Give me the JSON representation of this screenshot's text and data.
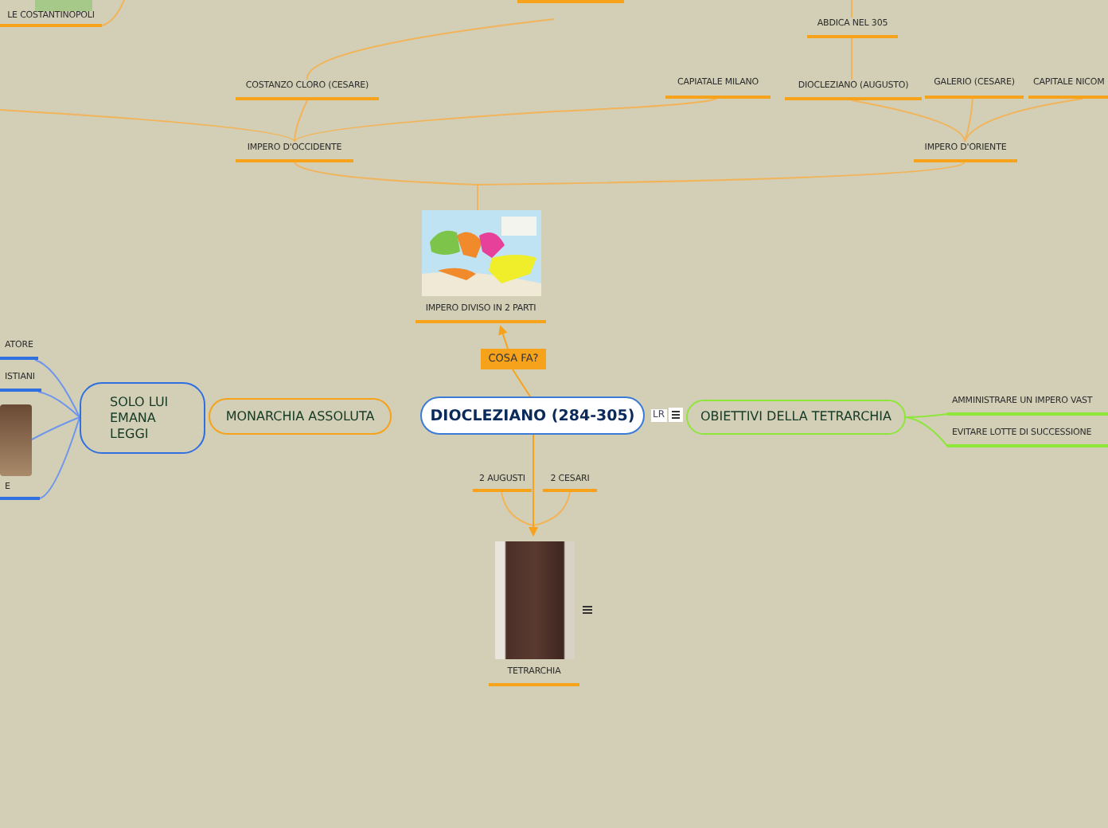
{
  "central": {
    "title": "DIOCLEZIANO (284-305)",
    "layout_badge": "LR",
    "notes": true
  },
  "nodes": [
    {
      "kind": "topic",
      "text": "LE COSTANTINOPOLI",
      "color": "#f7a21b"
    },
    {
      "kind": "topic",
      "text": "COSTANZO CLORO (CESARE)",
      "color": "#f7a21b"
    },
    {
      "kind": "topic",
      "text": "IMPERO D'OCCIDENTE",
      "color": "#f7a21b"
    },
    {
      "kind": "topic",
      "text": "ABDICA NEL 305",
      "color": "#f7a21b"
    },
    {
      "kind": "topic",
      "text": "CAPIATALE MILANO",
      "color": "#f7a21b"
    },
    {
      "kind": "topic",
      "text": "DIOCLEZIANO (AUGUSTO)",
      "color": "#f7a21b"
    },
    {
      "kind": "topic",
      "text": "GALERIO (CESARE)",
      "color": "#f7a21b"
    },
    {
      "kind": "topic",
      "text": "CAPITALE NICOM",
      "color": "#f7a21b"
    },
    {
      "kind": "topic",
      "text": "IMPERO D'ORIENTE",
      "color": "#f7a21b"
    },
    {
      "kind": "topic",
      "text": "2 AUGUSTI",
      "color": "#f7a21b"
    },
    {
      "kind": "topic",
      "text": "2 CESARI",
      "color": "#f7a21b"
    },
    {
      "kind": "topic",
      "text": "AMMINISTRARE UN IMPERO VAST",
      "color": "#8ee63a"
    },
    {
      "kind": "topic",
      "text": "EVITARE LOTTE DI SUCCESSIONE",
      "color": "#8ee63a"
    },
    {
      "kind": "topic",
      "text": "ATORE",
      "color": "#2f6fe0"
    },
    {
      "kind": "topic",
      "text": "ISTIANI",
      "color": "#2f6fe0"
    },
    {
      "kind": "topic",
      "text": "E",
      "color": "#2f6fe0"
    },
    {
      "kind": "map-topic",
      "text": "IMPERO DIVISO IN 2 PARTI",
      "color": "#f7a21b",
      "notes": false
    },
    {
      "kind": "photo-topic",
      "text": "TETRARCHIA",
      "color": "#f7a21b",
      "notes": true
    },
    {
      "kind": "photo"
    },
    {
      "kind": "map"
    },
    {
      "kind": "bubble",
      "text": "SOLO LUI EMANA LEGGI",
      "color": "#2f6fe0"
    },
    {
      "kind": "bubble",
      "text": "MONARCHIA ASSOLUTA",
      "color": "#f7a21b"
    },
    {
      "kind": "bubble",
      "text": "OBIETTIVI DELLA TETRARCHIA",
      "color": "#8ee63a"
    },
    {
      "kind": "label",
      "text": "COSA FA?",
      "color": "#f7a21b"
    }
  ]
}
